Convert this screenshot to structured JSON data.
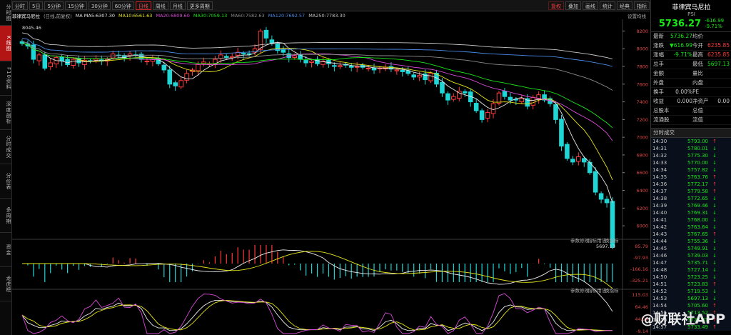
{
  "left_rail": [
    {
      "label": "分时图",
      "active": false
    },
    {
      "label": "K线图",
      "active": true
    },
    {
      "label": "F10资料",
      "active": false
    },
    {
      "label": "深度剖析",
      "active": false
    },
    {
      "label": "分时成交",
      "active": false
    },
    {
      "label": "分价表",
      "active": false
    },
    {
      "label": "多周期",
      "active": false
    },
    {
      "label": "资金",
      "active": false
    },
    {
      "label": "龙虎榜",
      "active": false
    }
  ],
  "toolbar": {
    "periods": [
      {
        "label": "分时",
        "active": false
      },
      {
        "label": "5日",
        "active": false
      },
      {
        "label": "5分钟",
        "active": false
      },
      {
        "label": "15分钟",
        "active": false
      },
      {
        "label": "30分钟",
        "active": false
      },
      {
        "label": "60分钟",
        "active": false
      },
      {
        "label": "日线",
        "active": true
      },
      {
        "label": "周线",
        "active": false
      },
      {
        "label": "月线",
        "active": false
      },
      {
        "label": "更多周期",
        "active": false
      }
    ],
    "right_buttons": [
      {
        "label": "复权",
        "red": true
      },
      {
        "label": "叠加",
        "red": false
      },
      {
        "label": "画线",
        "red": false
      },
      {
        "label": "统计",
        "red": false
      },
      {
        "label": "经典",
        "red": false
      },
      {
        "label": "指标",
        "red": false
      }
    ]
  },
  "ma_legend": {
    "instrument": "菲律宾马尼拉",
    "mode": "(日线,前复权)",
    "items": [
      {
        "text": "MA  MA5:6307.30",
        "color": "#e8e8e8"
      },
      {
        "text": "MA10:6561.63",
        "color": "#e6e619"
      },
      {
        "text": "MA20:6809.60",
        "color": "#d74ad7"
      },
      {
        "text": "MA30:7059.13",
        "color": "#19e619"
      },
      {
        "text": "MA60:7582.63",
        "color": "#8c8c8c"
      },
      {
        "text": "MA120:7692.57",
        "color": "#4a8ce8"
      },
      {
        "text": "MA250:7783.30",
        "color": "#c8c8c8"
      }
    ],
    "settings_label": "设置均线"
  },
  "chart_data": {
    "type": "candlestick",
    "price_axis": [
      8200,
      8000,
      7800,
      7600,
      7400,
      7200,
      7000,
      6800,
      6600,
      6400,
      6200,
      6000
    ],
    "high_label": "8045.46",
    "low_label": "5697.13",
    "ylim": [
      5880,
      8300
    ],
    "closes": [
      8060,
      8030,
      7880,
      7930,
      7780,
      7840,
      7900,
      7860,
      7820,
      7880,
      7840,
      7870,
      7860,
      7890,
      7860,
      7880,
      7940,
      7920,
      7900,
      7940,
      7930,
      7880,
      7860,
      7880,
      7830,
      7760,
      7600,
      7580,
      7640,
      7720,
      7760,
      7820,
      7850,
      7830,
      7880,
      7930,
      7900,
      7910,
      7960,
      7940,
      7940,
      8000,
      8200,
      8120,
      8060,
      7980,
      7960,
      7900,
      7920,
      7880,
      7840,
      7860,
      7830,
      7860,
      7830,
      7800,
      7810,
      7820,
      7790,
      7800,
      7790,
      7780,
      7760,
      7780,
      7790,
      7770,
      7760,
      7740,
      7720,
      7680,
      7700,
      7650,
      7720,
      7600,
      7500,
      7420,
      7460,
      7520,
      7500,
      7400,
      7300,
      7200,
      7280,
      7380,
      7500,
      7460,
      7420,
      7420,
      7440,
      7350,
      7450,
      7480,
      7420,
      7380,
      7200,
      6900,
      6760,
      6720,
      6780,
      6720,
      6600,
      6380,
      6300,
      6260,
      5760
    ],
    "macd_axis": [
      "85.79",
      "-97.93",
      "-166.16",
      "-325.21"
    ],
    "macd_label": {
      "name": "MACD(12,26,9)",
      "dif": "DIF:-325.211",
      "dea": "DEA:-229.516",
      "macd": "MACD:-197.390"
    },
    "kdj_axis": [
      "115.03",
      "64.46",
      "44.54",
      "-9.14"
    ],
    "kdj_label": {
      "name": "KDJ(9,3,3)",
      "k": "K:15.094",
      "d": "D:18.790",
      "j": "J:10.698"
    },
    "subpanel_buttons": [
      "参数修改",
      "指标用法",
      "换指标"
    ]
  },
  "right_panel": {
    "name": "菲律宾马尼拉",
    "code": "PSI",
    "price": "5736.27",
    "change": "-616.99",
    "change_pct": "-9.71%",
    "rows": [
      {
        "l1": "最新",
        "v1": "5736.27",
        "c1": "green",
        "l2": "均价",
        "v2": "",
        "c2": ""
      },
      {
        "l1": "涨跌",
        "v1": "▼616.99",
        "c1": "green",
        "l2": "今开",
        "v2": "6235.85",
        "c2": "red"
      },
      {
        "l1": "涨幅",
        "v1": "-9.71%",
        "c1": "green",
        "l2": "最高",
        "v2": "6235.85",
        "c2": "red"
      },
      {
        "l1": "总手",
        "v1": "",
        "c1": "",
        "l2": "最低",
        "v2": "5697.13",
        "c2": "green"
      },
      {
        "l1": "金额",
        "v1": "",
        "c1": "",
        "l2": "量比",
        "v2": "",
        "c2": ""
      },
      {
        "l1": "外盘",
        "v1": "",
        "c1": "",
        "l2": "内盘",
        "v2": "",
        "c2": ""
      },
      {
        "l1": "换手",
        "v1": "0.00%",
        "c1": "",
        "l2": "PE",
        "v2": "",
        "c2": ""
      },
      {
        "l1": "收益",
        "v1": "0.000",
        "c1": "",
        "l2": "净资产",
        "v2": "0.00",
        "c2": ""
      },
      {
        "l1": "总股本",
        "v1": "",
        "c1": "",
        "l2": "总值",
        "v2": "",
        "c2": ""
      },
      {
        "l1": "流通股",
        "v1": "",
        "c1": "",
        "l2": "流值",
        "v2": "",
        "c2": ""
      }
    ],
    "trades_title": "分时成交",
    "trades": [
      {
        "time": "14:30",
        "price": "5793.00",
        "dir": "up"
      },
      {
        "time": "14:31",
        "price": "5780.01",
        "dir": "down"
      },
      {
        "time": "14:32",
        "price": "5775.30",
        "dir": "down"
      },
      {
        "time": "14:33",
        "price": "5770.00",
        "dir": "down"
      },
      {
        "time": "14:34",
        "price": "5757.82",
        "dir": "down"
      },
      {
        "time": "14:35",
        "price": "5763.76",
        "dir": "up"
      },
      {
        "time": "14:36",
        "price": "5772.17",
        "dir": "up"
      },
      {
        "time": "14:37",
        "price": "5779.58",
        "dir": "up"
      },
      {
        "time": "14:38",
        "price": "5772.65",
        "dir": "down"
      },
      {
        "time": "14:39",
        "price": "5769.46",
        "dir": "down"
      },
      {
        "time": "14:40",
        "price": "5769.31",
        "dir": "down"
      },
      {
        "time": "14:41",
        "price": "5768.00",
        "dir": "down"
      },
      {
        "time": "14:42",
        "price": "5763.64",
        "dir": "down"
      },
      {
        "time": "14:43",
        "price": "5767.65",
        "dir": "up"
      },
      {
        "time": "14:44",
        "price": "5755.36",
        "dir": "down"
      },
      {
        "time": "14:45",
        "price": "5749.91",
        "dir": "down"
      },
      {
        "time": "14:46",
        "price": "5739.03",
        "dir": "down"
      },
      {
        "time": "14:47",
        "price": "5735.71",
        "dir": "down"
      },
      {
        "time": "14:48",
        "price": "5727.14",
        "dir": "down"
      },
      {
        "time": "14:50",
        "price": "5723.25",
        "dir": "down"
      },
      {
        "time": "14:51",
        "price": "5723.83",
        "dir": "up"
      },
      {
        "time": "14:52",
        "price": "5719.53",
        "dir": "down"
      },
      {
        "time": "14:53",
        "price": "5697.13",
        "dir": "down"
      },
      {
        "time": "14:54",
        "price": "5705.60",
        "dir": "up"
      },
      {
        "time": "14:55",
        "price": "5713.52",
        "dir": "up"
      },
      {
        "time": "14:56",
        "price": "5723.81",
        "dir": "up"
      },
      {
        "time": "14:57",
        "price": "5733.49",
        "dir": "up"
      }
    ]
  },
  "watermark": "@财联社APP",
  "colors": {
    "up": "#ff3b3b",
    "down": "#1fd6d6",
    "accent": "#c82828"
  }
}
